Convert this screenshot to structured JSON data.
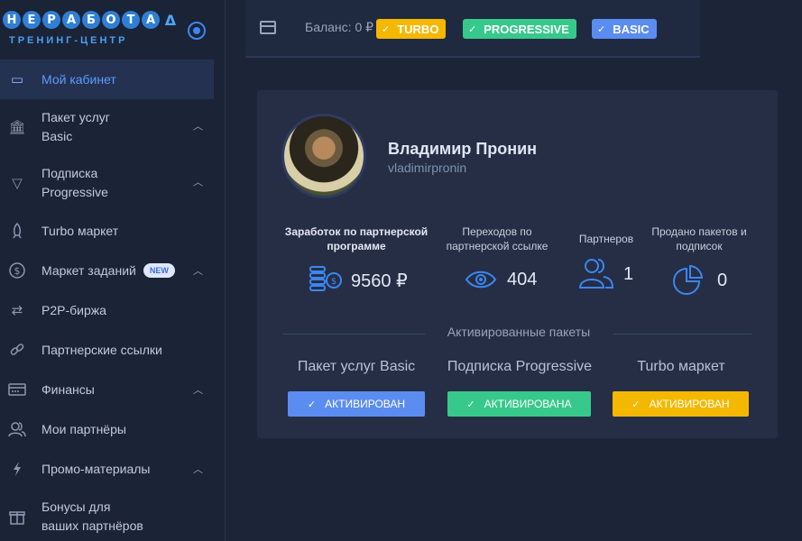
{
  "logo": {
    "letters": [
      "Н",
      "Е",
      "Р",
      "А",
      "Б",
      "О",
      "Т",
      "А"
    ],
    "triangle": "Δ",
    "subtitle": "ТРЕНИНГ-ЦЕНТР"
  },
  "sidebar": {
    "items": [
      {
        "label": "Мой кабинет",
        "icon": "monitor-icon",
        "glyph": "▭"
      },
      {
        "label": "Пакет услуг Basic",
        "line1": "Пакет услуг",
        "line2": "Basic",
        "icon": "bank-icon",
        "glyph": "🏛"
      },
      {
        "label": "Подписка Progressive",
        "line1": "Подписка",
        "line2": "Progressive",
        "icon": "triangle-icon",
        "glyph": "▽"
      },
      {
        "label": "Turbo маркет",
        "icon": "rocket-icon",
        "glyph": "🚀"
      },
      {
        "label": "Маркет заданий",
        "icon": "dollar-icon",
        "glyph": "$",
        "badge": "NEW"
      },
      {
        "label": "P2P-биржа",
        "icon": "exchange-icon",
        "glyph": "⇄"
      },
      {
        "label": "Партнерские ссылки",
        "icon": "link-icon",
        "glyph": "🔗"
      },
      {
        "label": "Финансы",
        "icon": "card-icon",
        "glyph": "▤"
      },
      {
        "label": "Мои партнёры",
        "icon": "users-icon",
        "glyph": "👥"
      },
      {
        "label": "Промо-материалы",
        "icon": "bolt-icon",
        "glyph": "ϟ"
      },
      {
        "label": "Бонусы для ваших партнёров",
        "line1": "Бонусы для",
        "line2": "ваших партнёров",
        "icon": "gift-icon",
        "glyph": "🎁"
      }
    ]
  },
  "topbar": {
    "balance": "Баланс: 0 ₽",
    "badges": [
      {
        "label": "TURBO",
        "color": "#f5b800"
      },
      {
        "label": "PROGRESSIVE",
        "color": "#37c98b"
      },
      {
        "label": "BASIC",
        "color": "#5b8cf0"
      }
    ],
    "check": "✓"
  },
  "profile": {
    "name": "Владимир Пронин",
    "login": "vladimirpronin"
  },
  "stats": [
    {
      "label": "Заработок по партнерской программе",
      "value": "9560 ₽",
      "icon": "coins-icon"
    },
    {
      "label": "Переходов по партнерской ссылке",
      "value": "404",
      "icon": "eye-icon"
    },
    {
      "label": "Партнеров",
      "value": "1",
      "icon": "partners-icon"
    },
    {
      "label": "Продано пакетов и подписок",
      "value": "0",
      "icon": "pie-chart-icon"
    }
  ],
  "packages": {
    "title": "Активированные пакеты",
    "items": [
      {
        "name": "Пакет услуг Basic",
        "status": "АКТИВИРОВАН",
        "color": "#5b8cf0"
      },
      {
        "name": "Подписка Progressive",
        "status": "АКТИВИРОВАНА",
        "color": "#37c98b"
      },
      {
        "name": "Turbo маркет",
        "status": "АКТИВИРОВАН",
        "color": "#f5b800"
      }
    ]
  }
}
